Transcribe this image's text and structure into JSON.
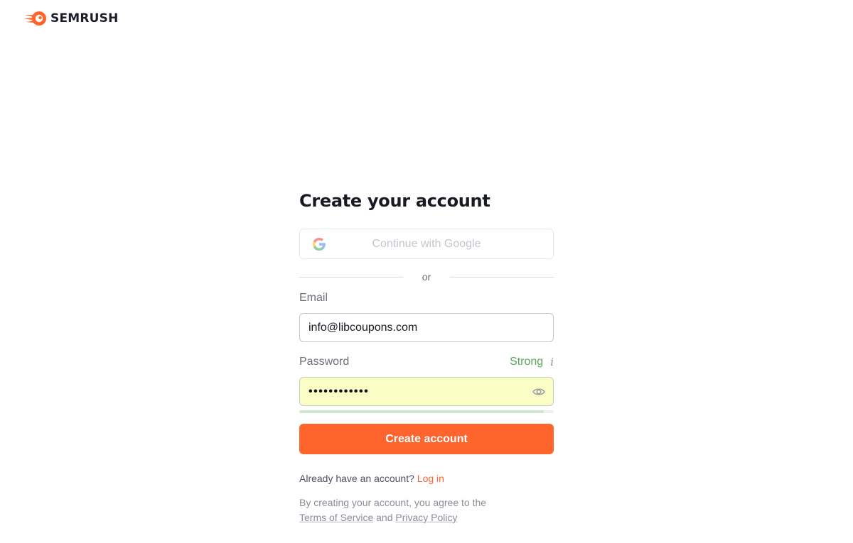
{
  "brand": {
    "name": "SEMRUSH",
    "logo_icon": "semrush-fireball-icon",
    "accent_color": "#ff642d"
  },
  "form": {
    "title": "Create your account",
    "google_button": {
      "label": "Continue with Google",
      "icon": "google-g-icon"
    },
    "divider_text": "or",
    "email": {
      "label": "Email",
      "value": "info@libcoupons.com"
    },
    "password": {
      "label": "Password",
      "masked_value": "••••••••••••",
      "character_count": 12,
      "strength_label": "Strong",
      "strength_color": "#5ba55b",
      "strength_fraction": 0.96,
      "info_icon": "info-icon",
      "toggle_icon": "eye-icon"
    },
    "submit_label": "Create account",
    "login_prompt": "Already have an account?",
    "login_link": "Log in",
    "terms_prefix": "By creating your account, you agree to the",
    "terms_link": "Terms of Service",
    "terms_and": "and",
    "privacy_link": "Privacy Policy"
  }
}
